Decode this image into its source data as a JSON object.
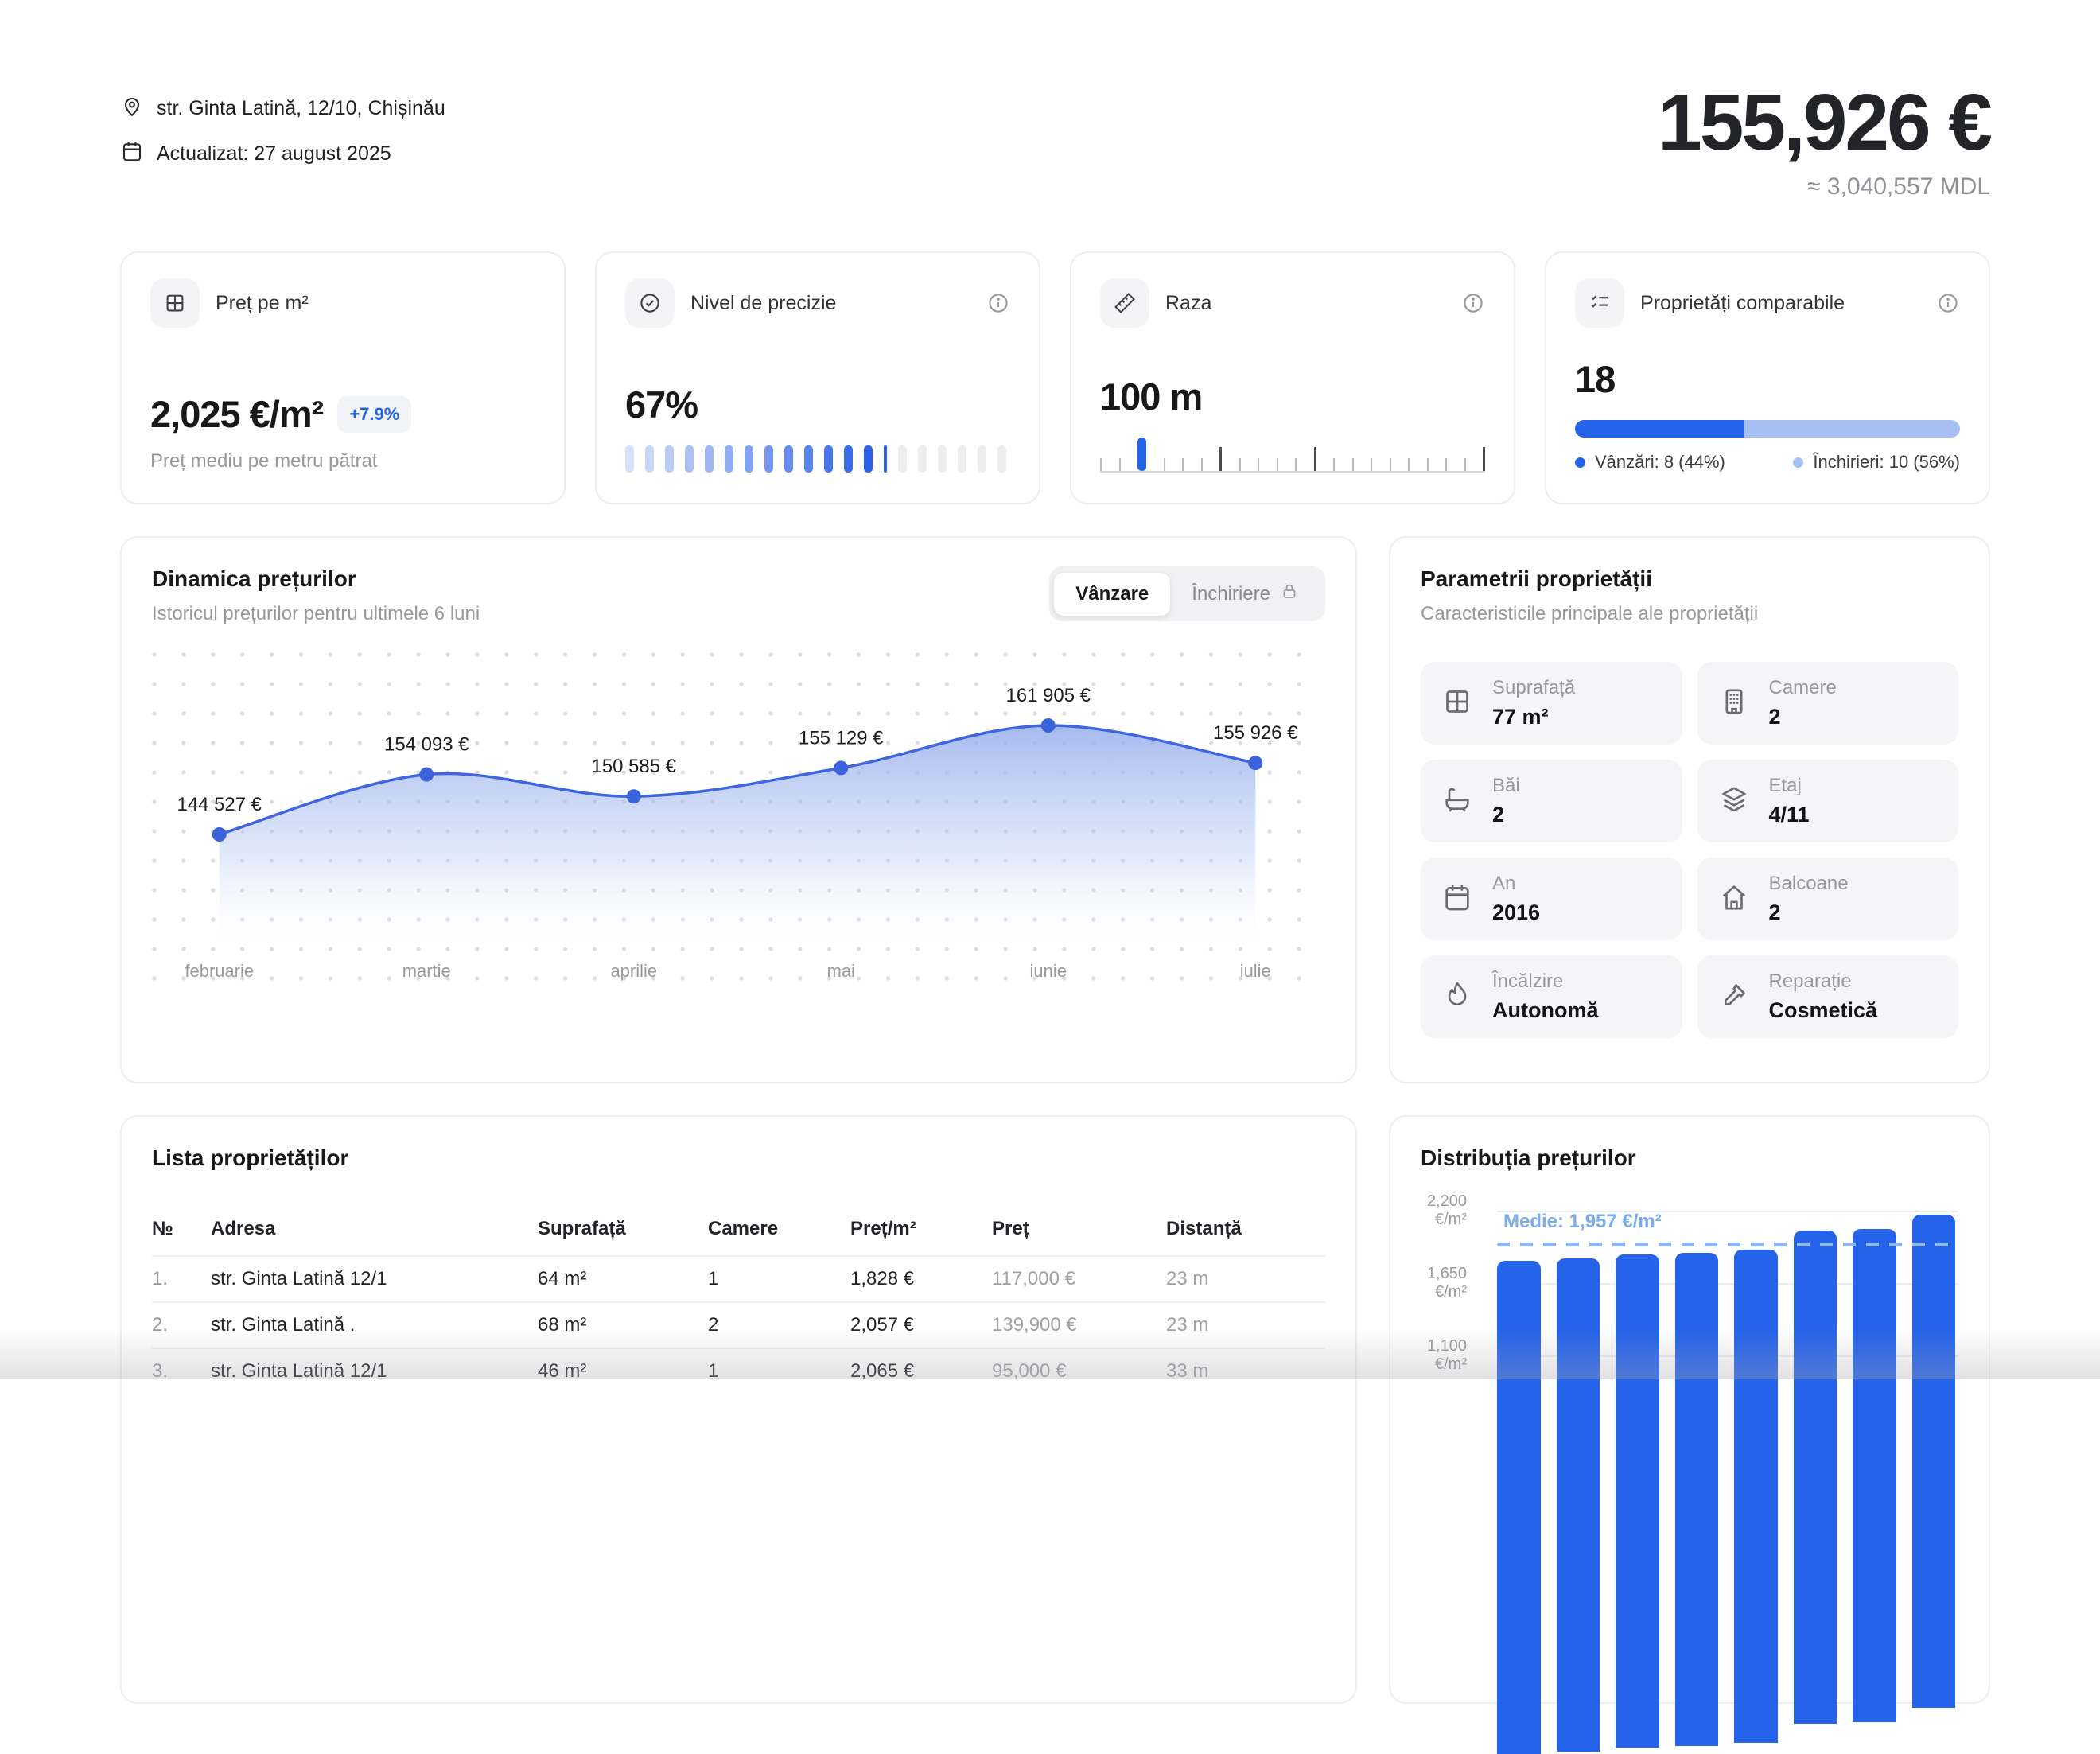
{
  "header": {
    "address": "str. Ginta Latină, 12/10, Chișinău",
    "updated": "Actualizat: 27 august 2025",
    "price_eur": "155,926 €",
    "price_mdl": "≈ 3,040,557 MDL"
  },
  "colors": {
    "accent": "#2563eb",
    "accent_light": "#a6c0f4",
    "line_blue": "#3f66de",
    "medie_blue": "#7bacf2",
    "seg_gray": "#ededef"
  },
  "stats": {
    "price_m2": {
      "icon": "grid-icon",
      "label": "Preț pe m²",
      "value": "2,025 €/m²",
      "badge": "+7.9%",
      "subtitle": "Preț mediu pe metru pătrat"
    },
    "precision": {
      "icon": "check-circle-icon",
      "label": "Nivel de precizie",
      "value": "67%",
      "percent": 67,
      "segments": 20
    },
    "radius": {
      "icon": "ruler-icon",
      "label": "Raza",
      "value": "100 m",
      "ticks": 21,
      "marker_index": 2,
      "major_ticks": [
        6,
        11,
        20
      ]
    },
    "comparables": {
      "icon": "checklist-icon",
      "label": "Proprietăți comparabile",
      "value": "18",
      "sales_pct": 44,
      "sales_label": "Vânzări: 8 (44%)",
      "rent_label": "Închirieri: 10 (56%)"
    }
  },
  "chart": {
    "title": "Dinamica prețurilor",
    "subtitle": "Istoricul prețurilor pentru ultimele 6 luni",
    "toggle_sale": "Vânzare",
    "toggle_rent": "Închiriere"
  },
  "chart_data": [
    {
      "type": "area",
      "title": "Dinamica prețurilor",
      "x": [
        "februarie",
        "martie",
        "aprilie",
        "mai",
        "iunie",
        "iulie"
      ],
      "values": [
        144527,
        154093,
        150585,
        155129,
        161905,
        155926
      ],
      "point_labels": [
        "144 527 €",
        "154 093 €",
        "150 585 €",
        "155 129 €",
        "161 905 €",
        "155 926 €"
      ],
      "legend_position": "none",
      "grid": "dots"
    },
    {
      "type": "bar",
      "title": "Distribuția prețurilor",
      "values": [
        1820,
        1840,
        1868,
        1882,
        1905,
        2052,
        2062,
        2170
      ],
      "ylabel": "€/m²",
      "yticks": [
        {
          "num": "2,200",
          "unit": "€/m²",
          "value": 2200
        },
        {
          "num": "1,650",
          "unit": "€/m²",
          "value": 1650
        },
        {
          "num": "1,100",
          "unit": "€/m²",
          "value": 1100
        }
      ],
      "ymax": 2200,
      "ystep": 550,
      "mean_value": 1957,
      "mean_label": "Medie: 1,957 €/m²"
    }
  ],
  "params": {
    "title": "Parametrii proprietății",
    "subtitle": "Caracteristicile principale ale proprietății",
    "items": [
      {
        "icon": "grid-icon",
        "label": "Suprafață",
        "value": "77 m²"
      },
      {
        "icon": "building-icon",
        "label": "Camere",
        "value": "2"
      },
      {
        "icon": "bath-icon",
        "label": "Băi",
        "value": "2"
      },
      {
        "icon": "layers-icon",
        "label": "Etaj",
        "value": "4/11"
      },
      {
        "icon": "calendar-icon",
        "label": "An",
        "value": "2016"
      },
      {
        "icon": "home-icon",
        "label": "Balcoane",
        "value": "2"
      },
      {
        "icon": "flame-icon",
        "label": "Încălzire",
        "value": "Autonomă"
      },
      {
        "icon": "hammer-icon",
        "label": "Reparație",
        "value": "Cosmetică"
      }
    ]
  },
  "listing": {
    "title": "Lista proprietăților",
    "columns": [
      "№",
      "Adresa",
      "Suprafață",
      "Camere",
      "Preț/m²",
      "Preț",
      "Distanță"
    ],
    "rows": [
      [
        "1.",
        "str. Ginta Latină 12/1",
        "64 m²",
        "1",
        "1,828 €",
        "117,000 €",
        "23 m"
      ],
      [
        "2.",
        "str. Ginta Latină .",
        "68 m²",
        "2",
        "2,057 €",
        "139,900 €",
        "23 m"
      ],
      [
        "3.",
        "str. Ginta Latină 12/1",
        "46 m²",
        "1",
        "2,065 €",
        "95,000 €",
        "33 m"
      ]
    ]
  },
  "distribution": {
    "title": "Distribuția prețurilor"
  }
}
